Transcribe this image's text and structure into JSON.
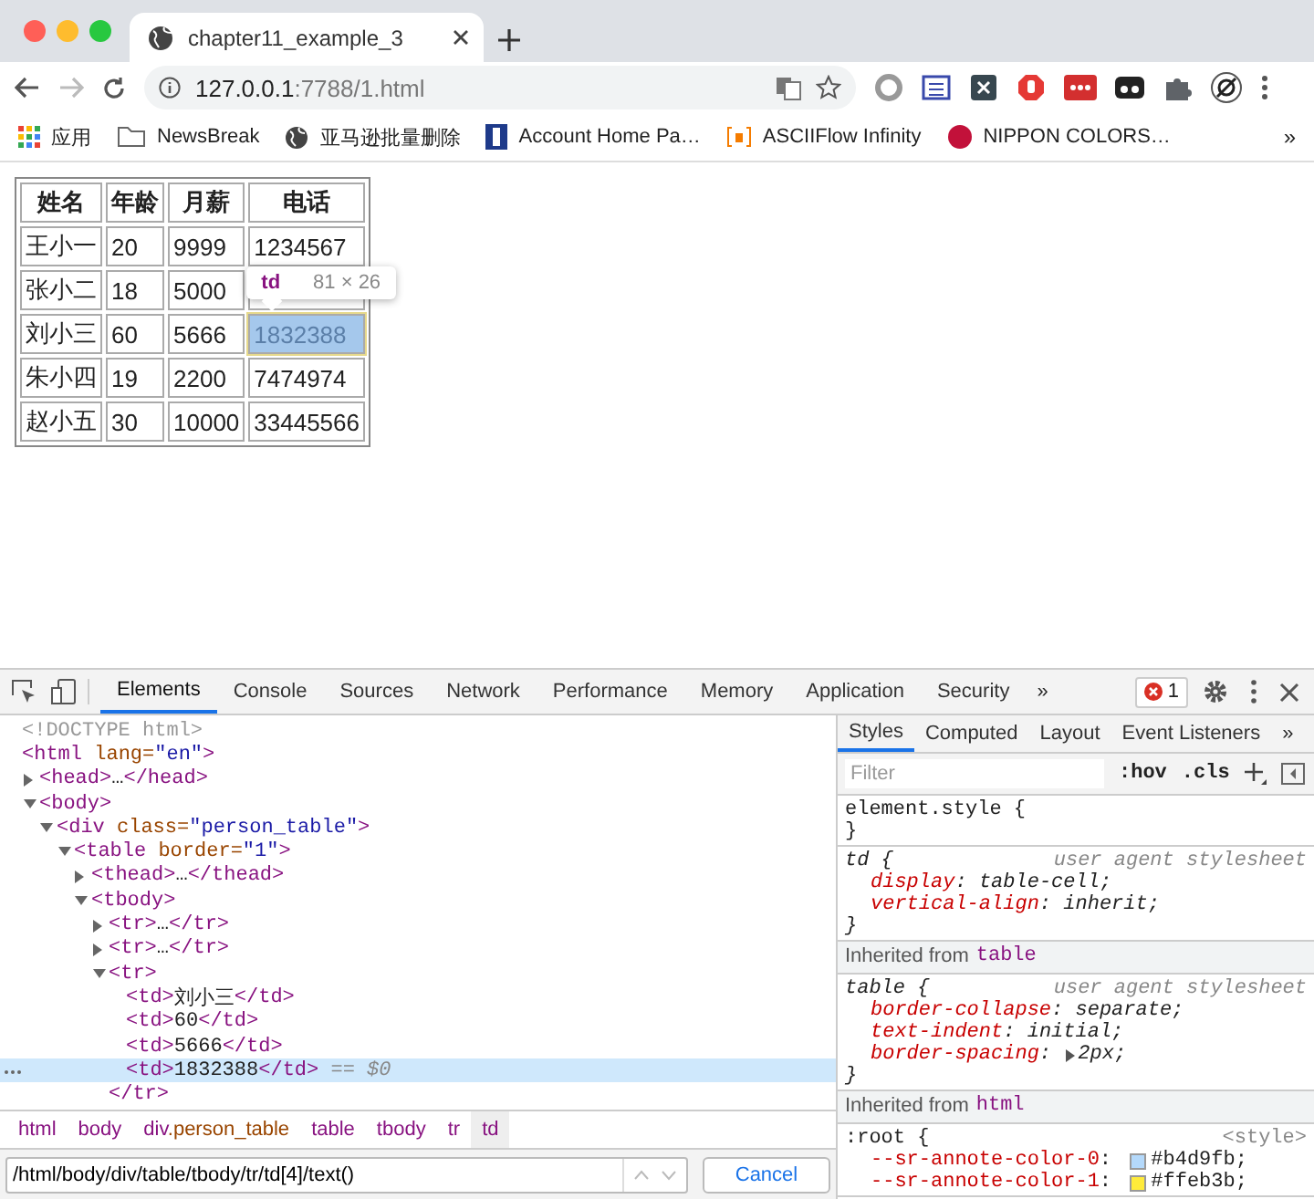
{
  "browser": {
    "tab": {
      "title": "chapter11_example_3"
    },
    "address": {
      "host": "127.0.0.1",
      "path": ":7788/1.html"
    },
    "bookmarks": [
      {
        "kind": "apps",
        "label": "应用"
      },
      {
        "kind": "folder",
        "label": "NewsBreak"
      },
      {
        "kind": "globe",
        "label": "亚马逊批量删除"
      },
      {
        "kind": "flag",
        "label": "Account Home Pa…"
      },
      {
        "kind": "bracket",
        "label": "ASCIIFlow Infinity"
      },
      {
        "kind": "dot",
        "label": "NIPPON COLORS…"
      }
    ],
    "bookmarks_more": "»"
  },
  "page": {
    "table": {
      "columns": [
        "姓名",
        "年龄",
        "月薪",
        "电话"
      ],
      "rows": [
        [
          {
            "text": "王小一",
            "selected": false
          },
          {
            "text": "20",
            "selected": false
          },
          {
            "text": "9999",
            "selected": false
          },
          {
            "text": "1234567",
            "selected": false
          }
        ],
        [
          {
            "text": "张小二",
            "selected": false
          },
          {
            "text": "18",
            "selected": false
          },
          {
            "text": "5000",
            "selected": false
          },
          {
            "selected": false
          }
        ],
        [
          {
            "text": "刘小三",
            "selected": false
          },
          {
            "text": "60",
            "selected": false
          },
          {
            "text": "5666",
            "selected": false
          },
          {
            "text": "1832388",
            "selected": true
          }
        ],
        [
          {
            "text": "朱小四",
            "selected": false
          },
          {
            "text": "19",
            "selected": false
          },
          {
            "text": "2200",
            "selected": false
          },
          {
            "text": "7474974",
            "selected": false
          }
        ],
        [
          {
            "text": "赵小五",
            "selected": false
          },
          {
            "text": "30",
            "selected": false
          },
          {
            "text": "10000",
            "selected": false
          },
          {
            "text": "33445566",
            "selected": false
          }
        ]
      ]
    },
    "tooltip": {
      "tag": "td",
      "size": "81 × 26"
    }
  },
  "devtools": {
    "tabs": [
      {
        "label": "Elements",
        "selected": true
      },
      {
        "label": "Console",
        "selected": false
      },
      {
        "label": "Sources",
        "selected": false
      },
      {
        "label": "Network",
        "selected": false
      },
      {
        "label": "Performance",
        "selected": false
      },
      {
        "label": "Memory",
        "selected": false
      },
      {
        "label": "Application",
        "selected": false
      },
      {
        "label": "Security",
        "selected": false
      }
    ],
    "more": "»",
    "errors": "1",
    "tree": [
      {
        "selected": false,
        "tokens": [
          {
            "kind": "doctype",
            "text": "<!DOCTYPE html>"
          }
        ]
      },
      {
        "selected": false,
        "tokens": [
          {
            "kind": "tag",
            "text": "<html"
          },
          {
            "kind": "attr",
            "text": " lang="
          },
          {
            "kind": "value",
            "text": "\"en\""
          },
          {
            "kind": "tag",
            "text": ">"
          }
        ],
        "children": [
          {
            "selected": false,
            "expanded": false,
            "tokens": [
              {
                "kind": "tag",
                "text": "<head>"
              },
              {
                "kind": "text",
                "text": "…"
              },
              {
                "kind": "tag",
                "text": "</head>"
              }
            ]
          },
          {
            "selected": false,
            "expanded": true,
            "tokens": [
              {
                "kind": "tag",
                "text": "<body>"
              }
            ],
            "children": [
              {
                "selected": false,
                "expanded": true,
                "tokens": [
                  {
                    "kind": "tag",
                    "text": "<div"
                  },
                  {
                    "kind": "attr",
                    "text": " class="
                  },
                  {
                    "kind": "value",
                    "text": "\"person_table\""
                  },
                  {
                    "kind": "tag",
                    "text": ">"
                  }
                ],
                "children": [
                  {
                    "selected": false,
                    "expanded": true,
                    "tokens": [
                      {
                        "kind": "tag",
                        "text": "<table"
                      },
                      {
                        "kind": "attr",
                        "text": " border="
                      },
                      {
                        "kind": "value",
                        "text": "\"1\""
                      },
                      {
                        "kind": "tag",
                        "text": ">"
                      }
                    ],
                    "children": [
                      {
                        "selected": false,
                        "expanded": false,
                        "tokens": [
                          {
                            "kind": "tag",
                            "text": "<thead>"
                          },
                          {
                            "kind": "text",
                            "text": "…"
                          },
                          {
                            "kind": "tag",
                            "text": "</thead>"
                          }
                        ]
                      },
                      {
                        "selected": false,
                        "expanded": true,
                        "tokens": [
                          {
                            "kind": "tag",
                            "text": "<tbody>"
                          }
                        ],
                        "children": [
                          {
                            "selected": false,
                            "expanded": false,
                            "tokens": [
                              {
                                "kind": "tag",
                                "text": "<tr>"
                              },
                              {
                                "kind": "text",
                                "text": "…"
                              },
                              {
                                "kind": "tag",
                                "text": "</tr>"
                              }
                            ]
                          },
                          {
                            "selected": false,
                            "expanded": false,
                            "tokens": [
                              {
                                "kind": "tag",
                                "text": "<tr>"
                              },
                              {
                                "kind": "text",
                                "text": "…"
                              },
                              {
                                "kind": "tag",
                                "text": "</tr>"
                              }
                            ]
                          },
                          {
                            "selected": false,
                            "expanded": true,
                            "tokens": [
                              {
                                "kind": "tag",
                                "text": "<tr>"
                              }
                            ],
                            "closing": [
                              {
                                "kind": "tag",
                                "text": "</tr>"
                              }
                            ],
                            "children": [
                              {
                                "selected": false,
                                "tokens": [
                                  {
                                    "kind": "tag",
                                    "text": "<td>"
                                  },
                                  {
                                    "kind": "text",
                                    "text": "刘小三"
                                  },
                                  {
                                    "kind": "tag",
                                    "text": "</td>"
                                  }
                                ]
                              },
                              {
                                "selected": false,
                                "tokens": [
                                  {
                                    "kind": "tag",
                                    "text": "<td>"
                                  },
                                  {
                                    "kind": "text",
                                    "text": "60"
                                  },
                                  {
                                    "kind": "tag",
                                    "text": "</td>"
                                  }
                                ]
                              },
                              {
                                "selected": false,
                                "tokens": [
                                  {
                                    "kind": "tag",
                                    "text": "<td>"
                                  },
                                  {
                                    "kind": "text",
                                    "text": "5666"
                                  },
                                  {
                                    "kind": "tag",
                                    "text": "</td>"
                                  }
                                ]
                              },
                              {
                                "selected": true,
                                "tokens": [
                                  {
                                    "kind": "tag",
                                    "text": "<td>"
                                  },
                                  {
                                    "kind": "text",
                                    "text": "1832388"
                                  },
                                  {
                                    "kind": "tag",
                                    "text": "</td>"
                                  },
                                  {
                                    "kind": "marker",
                                    "text": " == $0"
                                  }
                                ]
                              }
                            ]
                          }
                        ]
                      }
                    ]
                  }
                ]
              }
            ]
          }
        ]
      }
    ],
    "breadcrumbs": [
      {
        "tag": "html",
        "selected": false
      },
      {
        "tag": "body",
        "selected": false
      },
      {
        "tag": "div",
        "class": ".person_table",
        "selected": false
      },
      {
        "tag": "table",
        "selected": false
      },
      {
        "tag": "tbody",
        "selected": false
      },
      {
        "tag": "tr",
        "selected": false
      },
      {
        "tag": "td",
        "selected": true
      }
    ],
    "search": {
      "value": "/html/body/div/table/tbody/tr/td[4]/text()",
      "button": "Cancel"
    },
    "styles": {
      "tabs": [
        {
          "label": "Styles",
          "selected": true
        },
        {
          "label": "Computed",
          "selected": false
        },
        {
          "label": "Layout",
          "selected": false
        },
        {
          "label": "Event Listeners",
          "selected": false
        }
      ],
      "more": "»",
      "filter": {
        "placeholder": "Filter"
      },
      "hov": ":hov",
      "cls": ".cls",
      "sections": [
        {
          "kind": "rule",
          "selector": "element.style {",
          "italic": false,
          "close": "}"
        },
        {
          "kind": "rule",
          "selector": "td {",
          "source": "user agent stylesheet",
          "italic": true,
          "declarations": [
            {
              "name": "display",
              "sep": ":",
              "value": "table-cell;"
            },
            {
              "name": "vertical-align",
              "sep": ":",
              "value": "inherit;"
            }
          ],
          "close": "}"
        },
        {
          "kind": "inherited",
          "label": "Inherited from",
          "tag": "table"
        },
        {
          "kind": "rule",
          "selector": "table {",
          "source": "user agent stylesheet",
          "italic": true,
          "declarations": [
            {
              "name": "border-collapse",
              "sep": ":",
              "value": "separate;"
            },
            {
              "name": "text-indent",
              "sep": ":",
              "value": "initial;"
            },
            {
              "name": "border-spacing",
              "sep": ":",
              "value": "2px;",
              "expandable": true
            }
          ],
          "close": "}"
        },
        {
          "kind": "inherited",
          "label": "Inherited from",
          "tag": "html"
        },
        {
          "kind": "rule",
          "selector": ":root {",
          "source": "<style>",
          "italic": false,
          "declarations": [
            {
              "name": "--sr-annote-color-0",
              "sep": ":",
              "value": "#b4d9fb;",
              "color": "#b4d9fb"
            },
            {
              "name": "--sr-annote-color-1",
              "sep": ":",
              "value": "#ffeb3b;",
              "color": "#ffeb3b"
            }
          ]
        }
      ]
    }
  }
}
